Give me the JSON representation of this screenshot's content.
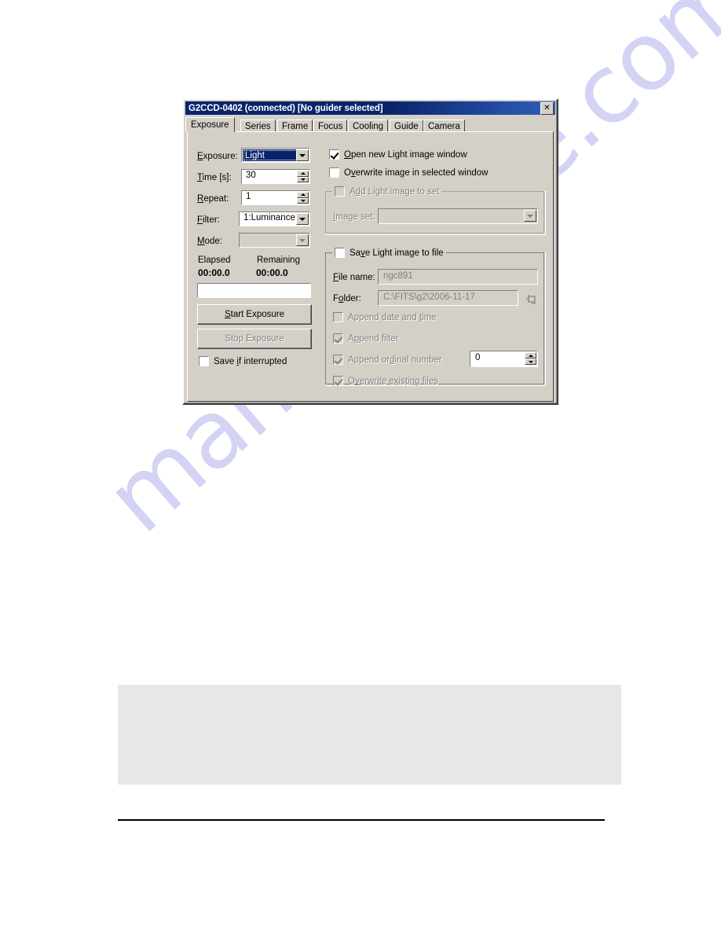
{
  "watermark": {
    "text": "manualshive.com"
  },
  "dialog": {
    "title": "G2CCD-0402 (connected) [No guider selected]",
    "close_icon": "close-icon",
    "tabs": [
      {
        "label": "Exposure",
        "active": true
      },
      {
        "label": "Series",
        "active": false
      },
      {
        "label": "Frame",
        "active": false
      },
      {
        "label": "Focus",
        "active": false
      },
      {
        "label": "Cooling",
        "active": false
      },
      {
        "label": "Guide",
        "active": false
      },
      {
        "label": "Camera",
        "active": false
      }
    ],
    "left": {
      "exposure_label": "Exposure:",
      "exposure_value": "Light",
      "time_label": "Time [s]:",
      "time_value": "30",
      "repeat_label": "Repeat:",
      "repeat_value": "1",
      "filter_label": "Filter:",
      "filter_value": "1:Luminance",
      "mode_label": "Mode:",
      "mode_value": "",
      "elapsed_label": "Elapsed",
      "elapsed_value": "00:00.0",
      "remaining_label": "Remaining",
      "remaining_value": "00:00.0",
      "progress_percent": 0,
      "start_button": "Start Exposure",
      "stop_button": "Stop Exposure",
      "save_if_interrupted": "Save if interrupted"
    },
    "right": {
      "open_new_window": "Open new Light image window",
      "overwrite_selected_window": "Overwrite image in selected window",
      "add_to_set_group": "Add Light image to set",
      "image_set_label": "Image set:",
      "image_set_value": "",
      "save_to_file_group": "Save Light image to file",
      "file_name_label": "File name:",
      "file_name_value": "ngc891",
      "folder_label": "Folder:",
      "folder_value": "C:\\FITS\\g2\\2006-11-17",
      "browse_icon": "folder-browse-icon",
      "append_date_time": "Append date and time",
      "append_filter": "Append filter",
      "append_ordinal": "Append ordinal number",
      "ordinal_value": "0",
      "overwrite_existing": "Overwrite existing files"
    }
  },
  "colors": {
    "face": "#d4d0c8",
    "title_active": "#0a246a",
    "selection": "#0a246a",
    "disabled_text": "#808080",
    "watermark": "#b9b9ee"
  }
}
